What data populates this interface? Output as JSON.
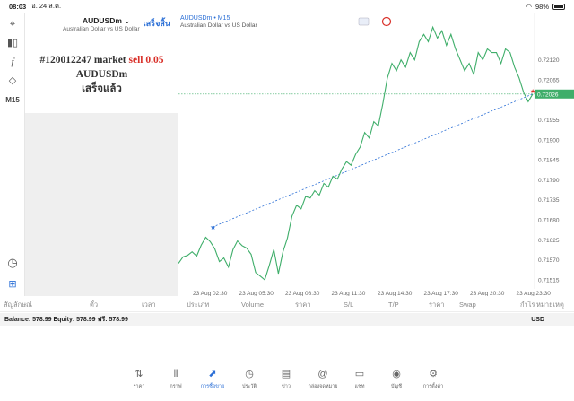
{
  "statusbar": {
    "time": "08:03",
    "date": "อ. 24 ส.ค.",
    "battery": "98%"
  },
  "panel": {
    "symbol": "AUDUSDm",
    "symbol_desc": "Australian Dollar vs US Dollar",
    "done_link": "เสร็จสิ้น",
    "order_prefix": "#120012247 market",
    "order_action": "sell 0.05",
    "order_symbol": "AUDUSDm",
    "order_status": "เสร็จแล้ว"
  },
  "lefttools": {
    "timeframe": "M15"
  },
  "chart_data": {
    "type": "line",
    "title": "AUDUSDm • M15",
    "subtitle": "Australian Dollar vs US Dollar",
    "current_price": "0.72026",
    "ylim": [
      0.7149,
      0.7225
    ],
    "yticks": [
      "0.72120",
      "0.72065",
      "0.72026",
      "0.71955",
      "0.71900",
      "0.71845",
      "0.71790",
      "0.71735",
      "0.71680",
      "0.71625",
      "0.71570",
      "0.71515"
    ],
    "xticks": [
      "23 Aug 02:30",
      "23 Aug 05:30",
      "23 Aug 08:30",
      "23 Aug 11:30",
      "23 Aug 14:30",
      "23 Aug 17:30",
      "23 Aug 20:30",
      "23 Aug 23:30"
    ],
    "series": [
      {
        "values": [
          0.7156,
          0.71578,
          0.71582,
          0.71592,
          0.7158,
          0.7161,
          0.71632,
          0.7162,
          0.716,
          0.71565,
          0.71575,
          0.7155,
          0.71598,
          0.71622,
          0.71609,
          0.71602,
          0.71585,
          0.71535,
          0.71525,
          0.71515,
          0.71555,
          0.71598,
          0.71532,
          0.71592,
          0.7163,
          0.7169,
          0.7172,
          0.7171,
          0.71744,
          0.7174,
          0.7176,
          0.71748,
          0.7178,
          0.7177,
          0.718,
          0.71792,
          0.7182,
          0.7184,
          0.7183,
          0.7186,
          0.7188,
          0.7192,
          0.71905,
          0.7195,
          0.71938,
          0.72,
          0.7207,
          0.7211,
          0.7209,
          0.7212,
          0.721,
          0.7214,
          0.7212,
          0.7217,
          0.7219,
          0.7217,
          0.7221,
          0.7218,
          0.722,
          0.7216,
          0.7219,
          0.7215,
          0.7212,
          0.7209,
          0.7211,
          0.7208,
          0.7214,
          0.7212,
          0.7215,
          0.7214,
          0.7214,
          0.7211,
          0.7215,
          0.7214,
          0.721,
          0.7207,
          0.7203,
          0.72005,
          0.72026
        ]
      }
    ],
    "trendline": {
      "from": [
        0.7165,
        0.7166
      ],
      "to": [
        0.7232,
        0.72026
      ]
    }
  },
  "table": {
    "headers": [
      "สัญลักษณ์",
      "ตั๋ว",
      "เวลา",
      "ประเภท",
      "Volume",
      "ราคา",
      "S/L",
      "T/P",
      "ราคา",
      "Swap",
      "กำไร",
      "หมายเหตุ"
    ]
  },
  "balance": {
    "text": "Balance: 578.99 Equity: 578.99 ฟรี: 578.99",
    "currency": "USD"
  },
  "tabs": [
    {
      "label": "ราคา",
      "icon": "arrows-updown-icon"
    },
    {
      "label": "กราฟ",
      "icon": "candles-icon"
    },
    {
      "label": "การซื้อขาย",
      "icon": "trade-icon"
    },
    {
      "label": "ประวัติ",
      "icon": "history-icon"
    },
    {
      "label": "ข่าว",
      "icon": "news-icon"
    },
    {
      "label": "กล่องจดหมาย",
      "icon": "mail-icon"
    },
    {
      "label": "แชท",
      "icon": "chat-icon"
    },
    {
      "label": "บัญชี",
      "icon": "account-icon"
    },
    {
      "label": "การตั้งค่า",
      "icon": "gear-icon"
    }
  ],
  "colors": {
    "accent": "#2b6fd6",
    "sell": "#d9312a",
    "line": "#3fae6a"
  }
}
